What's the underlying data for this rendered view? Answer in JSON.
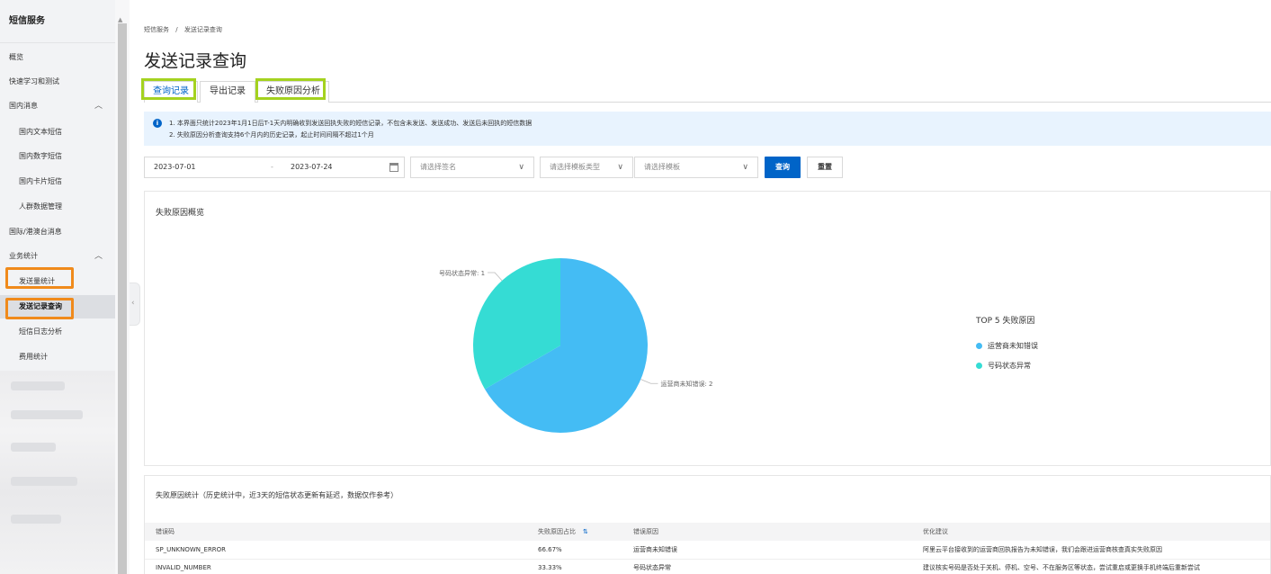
{
  "sidebar": {
    "title": "短信服务",
    "items": [
      {
        "label": "概览"
      },
      {
        "label": "快速学习和测试"
      },
      {
        "label": "国内消息"
      },
      {
        "label": "国内文本短信"
      },
      {
        "label": "国内数字短信"
      },
      {
        "label": "国内卡片短信"
      },
      {
        "label": "人群数据管理"
      },
      {
        "label": "国际/港澳台消息"
      },
      {
        "label": "业务统计"
      },
      {
        "label": "发送量统计"
      },
      {
        "label": "发送记录查询"
      },
      {
        "label": "短信日志分析"
      },
      {
        "label": "费用统计"
      }
    ],
    "chevron": "︿",
    "collapse": "‹"
  },
  "breadcrumb": {
    "root": "短信服务",
    "separator": "/",
    "current": "发送记录查询"
  },
  "page_title": "发送记录查询",
  "tabs": [
    {
      "label": "查询记录"
    },
    {
      "label": "导出记录"
    },
    {
      "label": "失败原因分析"
    }
  ],
  "notice": {
    "icon": "i",
    "line1": "1. 本界面只统计2023年1月1日后T-1天内明确收到发送回执失败的短信记录，不包含未发送、发送成功、发送后未回执的短信数据",
    "line2": "2. 失败原因分析查询支持6个月内的历史记录，起止时间间隔不超过1个月"
  },
  "filters": {
    "date_start": "2023-07-01",
    "date_sep": "-",
    "date_end": "2023-07-24",
    "sign_placeholder": "请选择签名",
    "template_type_placeholder": "请选择模板类型",
    "template_placeholder": "请选择模板",
    "chevron": "∨",
    "query_label": "查询",
    "reset_label": "重置"
  },
  "overview": {
    "title": "失败原因概览"
  },
  "chart_data": {
    "type": "pie",
    "slices": [
      {
        "label": "运营商未知错误",
        "value": 2,
        "color": "#44bcf4",
        "data_label": "运营商未知错误: 2"
      },
      {
        "label": "号码状态异常",
        "value": 1,
        "color": "#35dcd4",
        "data_label": "号码状态异常: 1"
      }
    ],
    "legend_title": "TOP 5 失败原因",
    "legend_placement": "right"
  },
  "stats": {
    "title": "失败原因统计（历史统计中，近3天的短信状态更新有延迟，数据仅作参考）",
    "columns": [
      "错误码",
      "失败原因占比",
      "错误原因",
      "优化建议"
    ],
    "sort_icon": "⇅",
    "rows": [
      [
        "SP_UNKNOWN_ERROR",
        "66.67%",
        "运营商未知错误",
        "阿里云平台接收到的运营商回执报告为未知错误，我们会跟进运营商核查真实失败原因"
      ],
      [
        "INVALID_NUMBER",
        "33.33%",
        "号码状态异常",
        "建议核实号码是否处于关机、停机、空号、不在服务区等状态，尝试重启或更换手机终端后重新尝试"
      ]
    ]
  }
}
